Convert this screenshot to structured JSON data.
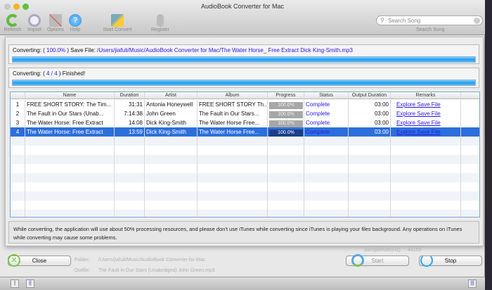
{
  "window": {
    "title": "AudioBook Converter for Mac"
  },
  "toolbar": {
    "refresh": "Refresh",
    "import": "Import",
    "options": "Options",
    "help": "Help",
    "start_convert": "Start Convert",
    "register": "Register"
  },
  "search": {
    "placeholder": "Search Song",
    "label": "Search Song"
  },
  "background": {
    "folder_label": "Folder:",
    "folder_value": "/Users/jiafuli/Music/AudioBook Converter for Mac",
    "outfile_label": "Outfile:",
    "outfile_value": "The Fault in Our Stars (Unabridged) John Green.mp3",
    "samplerate_label": "SampleRate(Hz)",
    "samplerate_value": "44100"
  },
  "progress_file": {
    "prefix": "Converting: (",
    "percent": "100.0%",
    "mid": ") Save File:",
    "path": "/Users/jiafuli/Music/AudioBook Converter for Mac/The Water Horse_ Free Extract Dick King-Smith.mp3",
    "fill": 1.0
  },
  "progress_total": {
    "prefix": "Converting: (",
    "current": "4",
    "sep": "/",
    "total": "4",
    "suffix": ") Finished!",
    "fill": 1.0
  },
  "table": {
    "columns": [
      "",
      "Name",
      "Duration",
      "Artist",
      "Album",
      "Progress",
      "Status",
      "Output Duration",
      "Remarks"
    ],
    "rows": [
      {
        "n": "1",
        "name": "FREE SHORT STORY: The Tim...",
        "duration": "31:31",
        "artist": "Antonia Honeywell",
        "album": "FREE SHORT STORY Th...",
        "progress": "100.0%",
        "status": "Complete",
        "output": "03:00",
        "remarks": "Explore Save File"
      },
      {
        "n": "2",
        "name": "The Fault in Our Stars (Unab...",
        "duration": "7:14:38",
        "artist": "John Green",
        "album": "The Fault in Our Stars...",
        "progress": "100.0%",
        "status": "Complete",
        "output": "03:00",
        "remarks": "Explore Save File"
      },
      {
        "n": "3",
        "name": "The Water Horse: Free Extract",
        "duration": "14:08",
        "artist": "Dick King-Smith",
        "album": "The Water Horse Free...",
        "progress": "100.0%",
        "status": "Complete",
        "output": "03:00",
        "remarks": "Explore Save File"
      },
      {
        "n": "4",
        "name": "The Water Horse: Free Extract",
        "duration": "13:59",
        "artist": "Dick King-Smith",
        "album": "The Water Horse Free...",
        "progress": "100.0%",
        "status": "Complete",
        "output": "03:00",
        "remarks": "Explore Save File",
        "selected": true
      }
    ]
  },
  "notice": "While converting, the application will use about 50% processing resources, and please don't use iTunes while converting since iTunes is playing your files background. Any operations on iTunes while converting may cause some problems.",
  "buttons": {
    "close": "Close",
    "start": "Start",
    "stop": "Stop"
  },
  "colors": {
    "accent": "#2c6fdc",
    "link": "#2a18e6",
    "progress": "#1a9cf0"
  }
}
